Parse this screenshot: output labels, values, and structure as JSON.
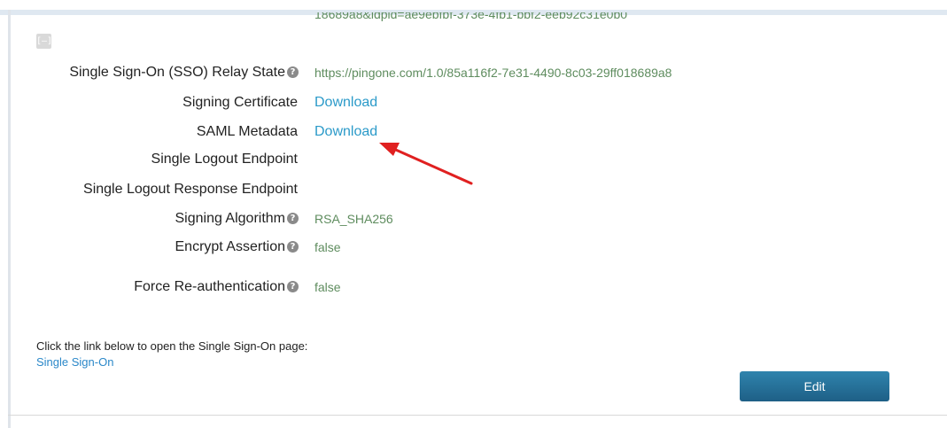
{
  "clipped_url": "18689a8&idpid=ae9ebfbf-373e-4fb1-bbf2-eeb92c31e0b0",
  "collapse_label": "[–]",
  "fields": {
    "relay_state": {
      "label": "Single Sign-On (SSO) Relay State",
      "value": "https://pingone.com/1.0/85a116f2-7e31-4490-8c03-29ff018689a8"
    },
    "signing_certificate": {
      "label": "Signing Certificate",
      "value": "Download"
    },
    "saml_metadata": {
      "label": "SAML Metadata",
      "value": "Download"
    },
    "logout_endpoint": {
      "label": "Single Logout Endpoint",
      "value": ""
    },
    "logout_response_endpoint": {
      "label": "Single Logout Response Endpoint",
      "value": ""
    },
    "signing_algorithm": {
      "label": "Signing Algorithm",
      "value": "RSA_SHA256"
    },
    "encrypt_assertion": {
      "label": "Encrypt Assertion",
      "value": "false"
    },
    "force_reauth": {
      "label": "Force Re-authentication",
      "value": "false"
    }
  },
  "help_glyph": "?",
  "footer": {
    "instruction": "Click the link below to open the Single Sign-On page:",
    "link": "Single Sign-On"
  },
  "buttons": {
    "edit": "Edit"
  },
  "colors": {
    "value_text": "#5e8c5e",
    "link": "#2b9ac9",
    "button": "#1e5f86",
    "annotation_arrow": "#e02020"
  }
}
